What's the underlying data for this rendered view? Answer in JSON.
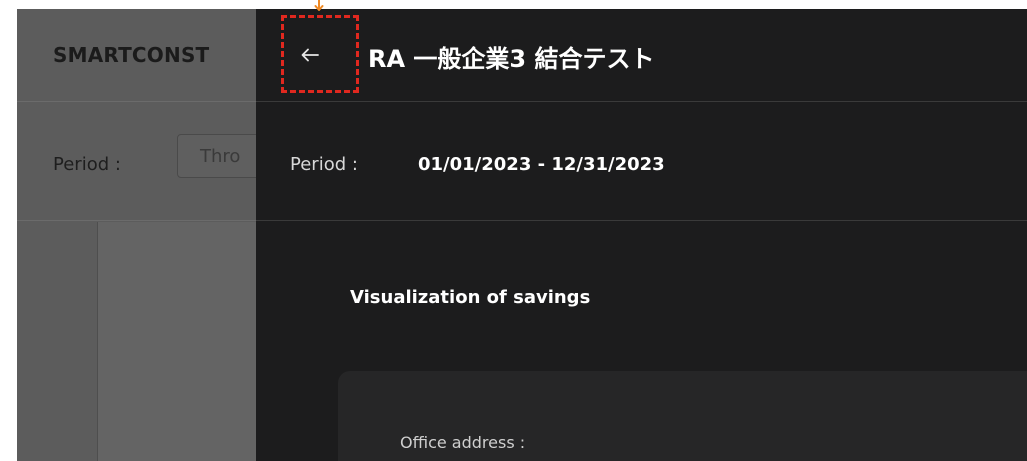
{
  "background_page": {
    "brand": "SMARTCONST",
    "period_label": "Period :",
    "period_placeholder": "Thro"
  },
  "drawer": {
    "back_icon": "arrow-left-icon",
    "title": "RA 一般企業3 結合テスト",
    "period_label": "Period :",
    "period_value": "01/01/2023 - 12/31/2023",
    "section_title": "Visualization of savings",
    "card": {
      "office_address_label": "Office address :"
    }
  },
  "annotation": {
    "target": "back-button",
    "color": "#e0281f",
    "arrow_color": "#f08a24"
  },
  "colors": {
    "drawer_bg": "#1c1c1d",
    "card_bg": "#262627",
    "overlay_bg": "#5c5c5c"
  }
}
